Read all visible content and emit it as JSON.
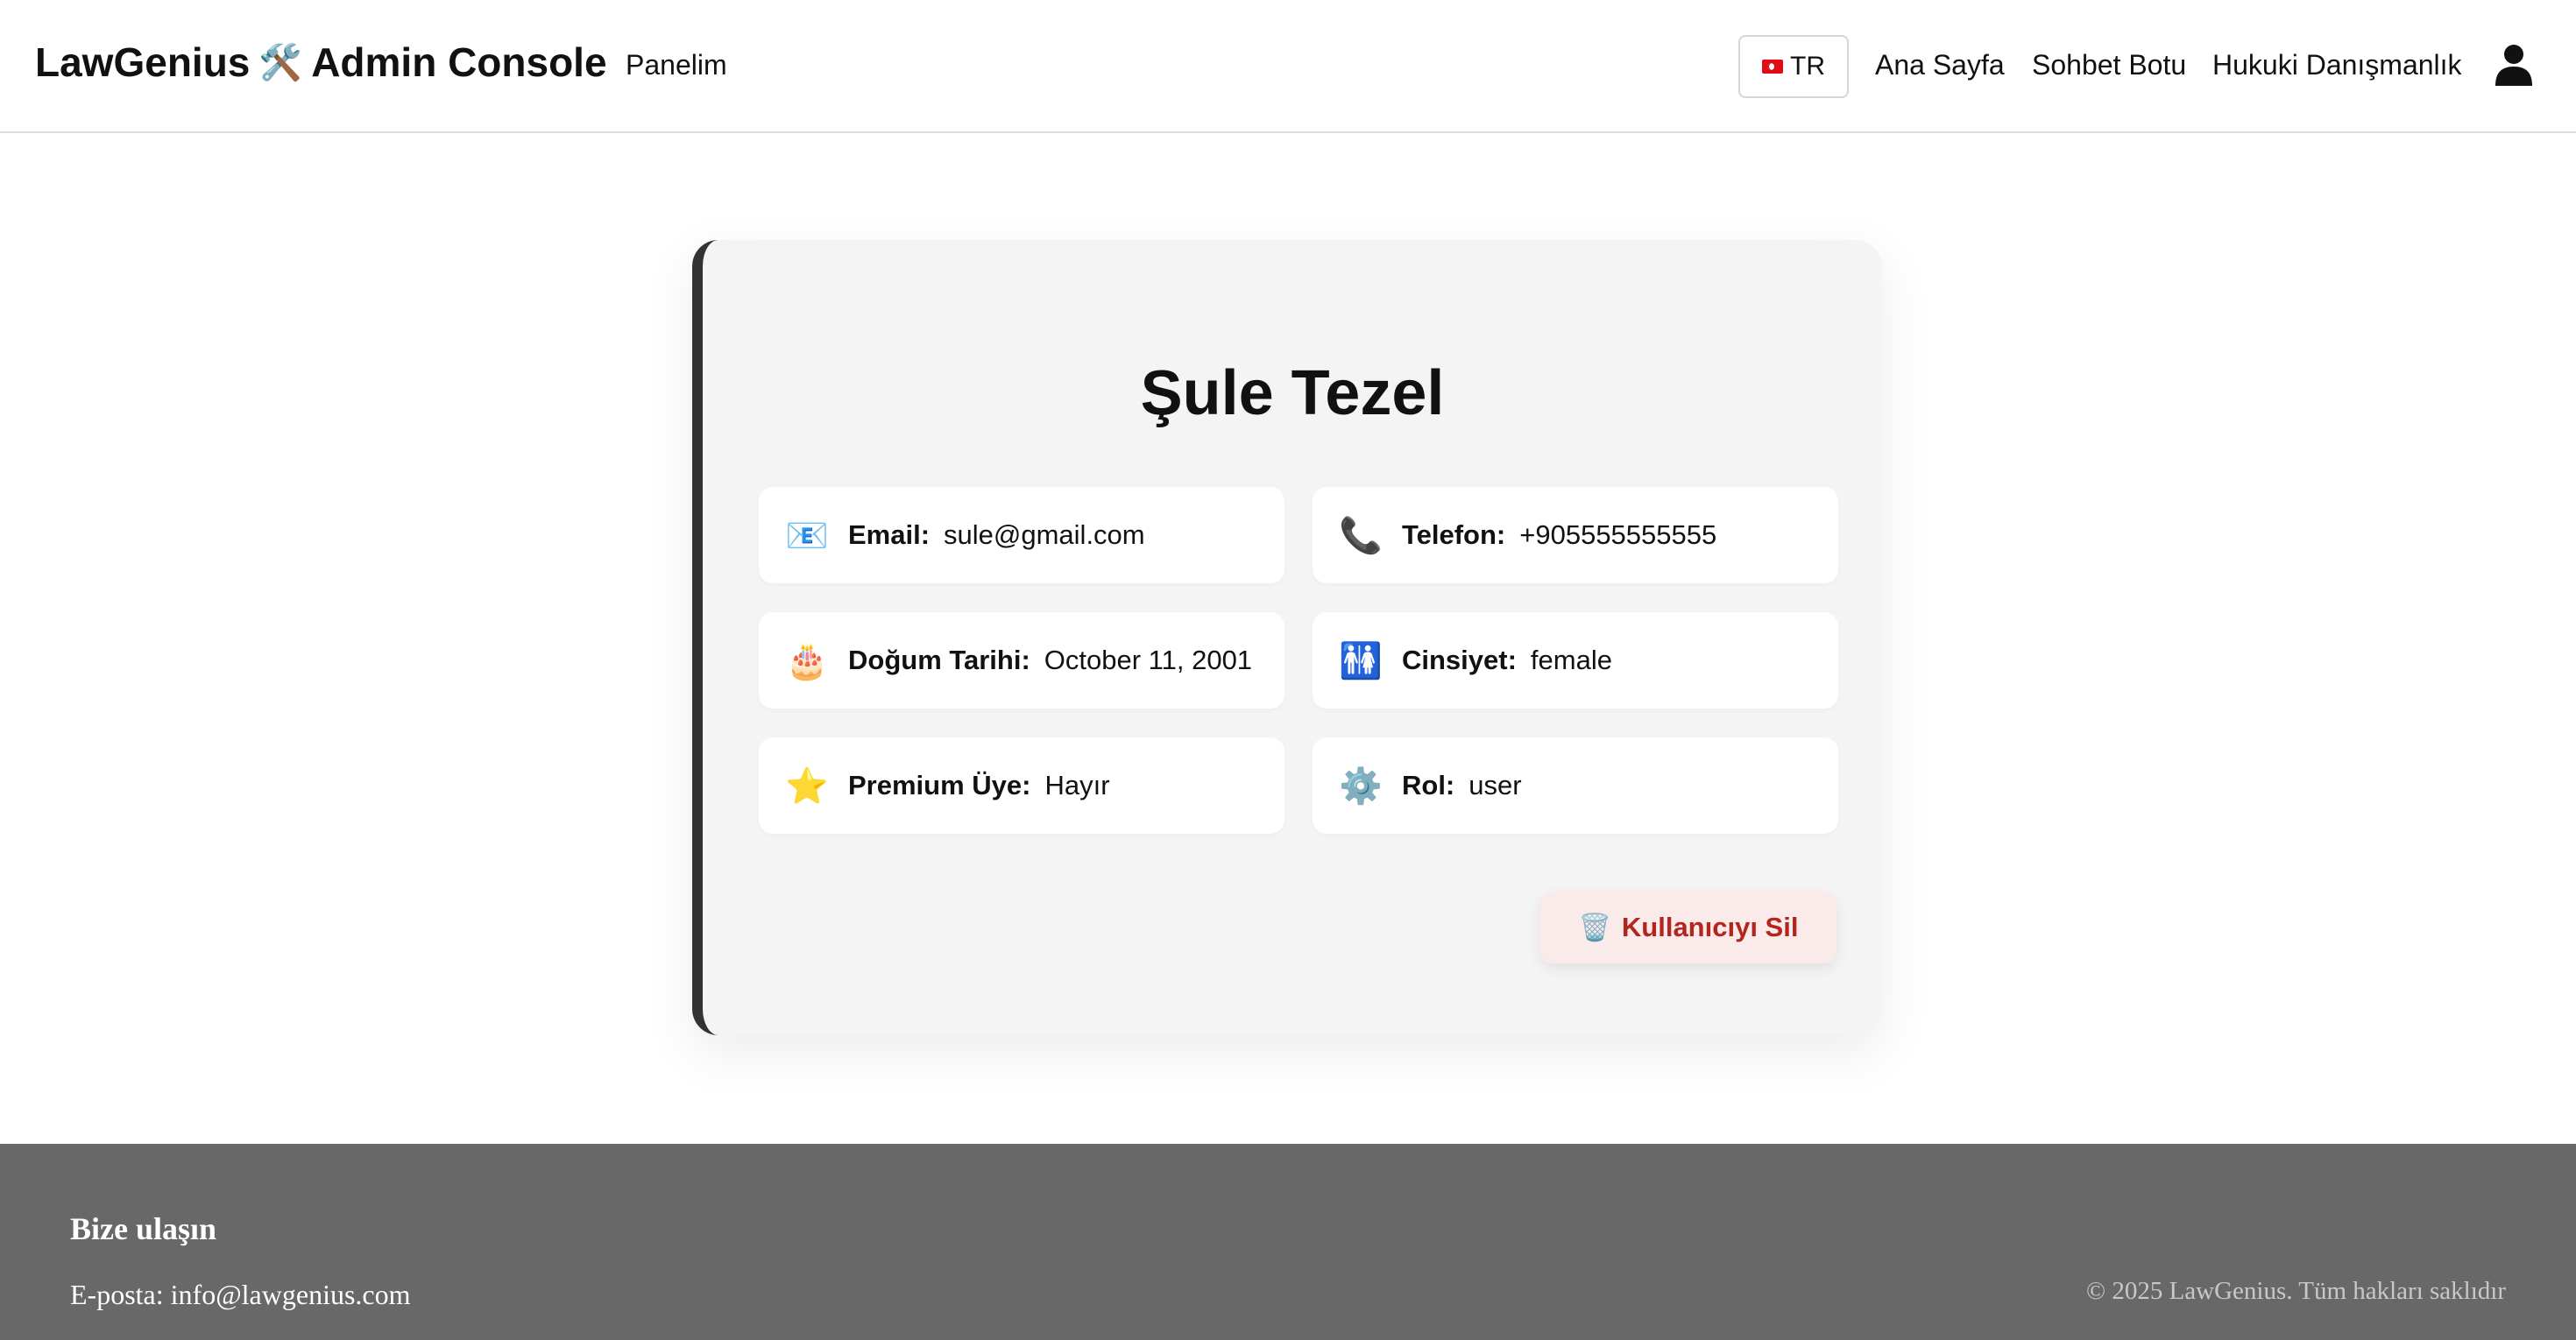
{
  "header": {
    "brand_left": "LawGenius",
    "brand_icon": "🛠️",
    "brand_right": "Admin Console",
    "panel_link": "Panelim",
    "language": "TR",
    "nav": [
      "Ana Sayfa",
      "Sohbet Botu",
      "Hukuki Danışmanlık"
    ]
  },
  "profile": {
    "name": "Şule Tezel",
    "fields": [
      {
        "icon": "📧",
        "label": "Email:",
        "value": "sule@gmail.com"
      },
      {
        "icon": "📞",
        "label": "Telefon:",
        "value": "+905555555555"
      },
      {
        "icon": "🎂",
        "label": "Doğum Tarihi:",
        "value": "October 11, 2001"
      },
      {
        "icon": "🚻",
        "label": "Cinsiyet:",
        "value": "female"
      },
      {
        "icon": "⭐",
        "label": "Premium Üye:",
        "value": "Hayır"
      },
      {
        "icon": "⚙️",
        "label": "Rol:",
        "value": "user"
      }
    ],
    "delete_icon": "🗑️",
    "delete_label": "Kullanıcıyı Sil"
  },
  "footer": {
    "title": "Bize ulaşın",
    "email": "E-posta: info@lawgenius.com",
    "copyright": "© 2025 LawGenius. Tüm hakları saklıdır"
  }
}
